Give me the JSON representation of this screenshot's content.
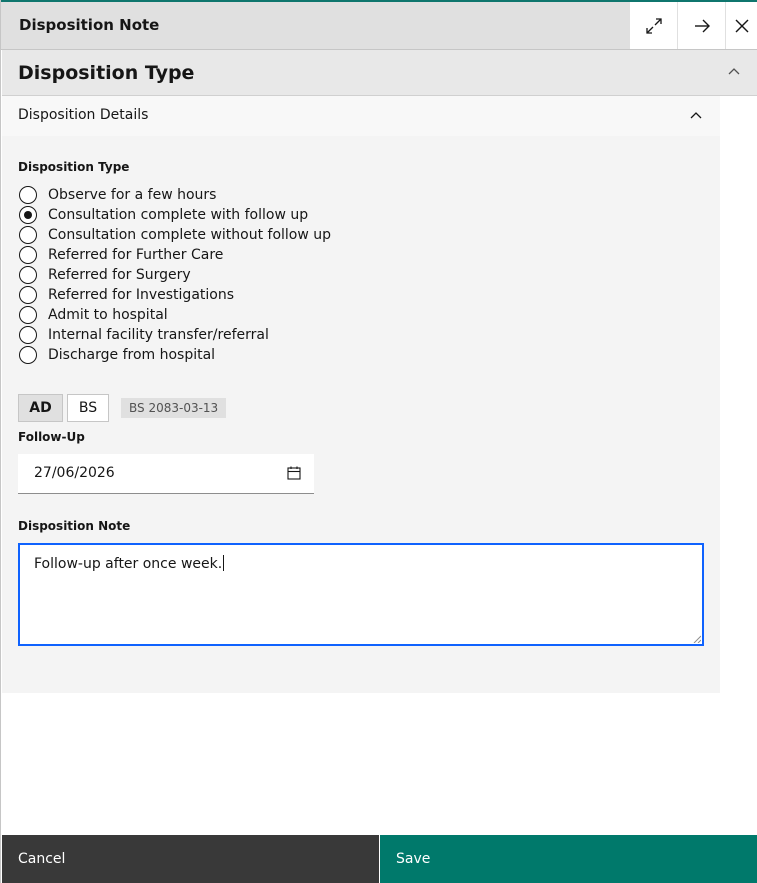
{
  "panel": {
    "title": "Disposition Note",
    "accent_color": "#0f766e",
    "icons": [
      "maximize-icon",
      "arrow-right-icon",
      "close-icon"
    ]
  },
  "section": {
    "title": "Disposition Type"
  },
  "accordion": {
    "title": "Disposition Details"
  },
  "form": {
    "disposition_type_label": "Disposition Type",
    "options": [
      {
        "label": "Observe for a few hours",
        "selected": false
      },
      {
        "label": "Consultation complete with follow up",
        "selected": true
      },
      {
        "label": "Consultation complete without follow up",
        "selected": false
      },
      {
        "label": "Referred for Further Care",
        "selected": false
      },
      {
        "label": "Referred for Surgery",
        "selected": false
      },
      {
        "label": "Referred for Investigations",
        "selected": false
      },
      {
        "label": "Admit to hospital",
        "selected": false
      },
      {
        "label": "Internal facility transfer/referral",
        "selected": false
      },
      {
        "label": "Discharge from hospital",
        "selected": false
      }
    ],
    "calendar_toggle": {
      "ad_label": "AD",
      "bs_label": "BS",
      "selected": "AD",
      "bs_date": "BS 2083-03-13"
    },
    "follow_up_label": "Follow-Up",
    "follow_up_value": "27/06/2026",
    "note_label": "Disposition Note",
    "note_value": "Follow-up after once week."
  },
  "footer": {
    "cancel_label": "Cancel",
    "save_label": "Save",
    "cancel_color": "#393939",
    "save_color": "#00796b"
  }
}
